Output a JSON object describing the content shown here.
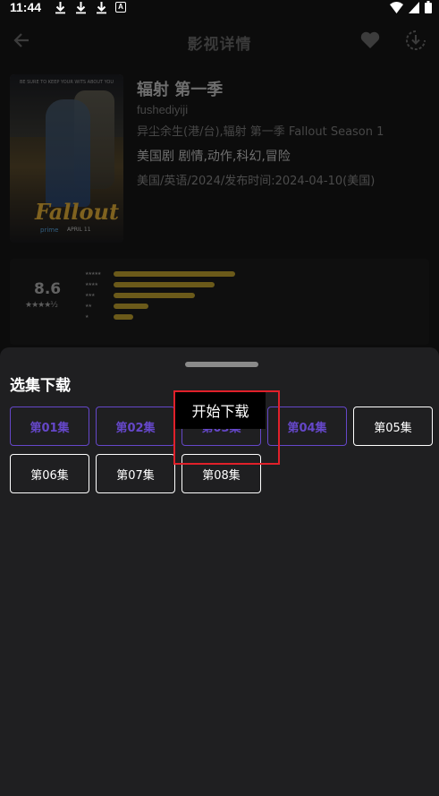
{
  "status_bar": {
    "time": "11:44",
    "a_badge": "A"
  },
  "header": {
    "title": "影视详情",
    "back_icon": "arrow-left-icon",
    "favorite_icon": "heart-icon",
    "download_icon": "download-circle-icon"
  },
  "movie": {
    "title": "辐射 第一季",
    "subtitle": "fushediyiji",
    "aliases": "异尘余生(港/台),辐射 第一季 Fallout Season 1",
    "genres": "美国剧 剧情,动作,科幻,冒险",
    "meta": "美国/英语/2024/发布时间:2024-04-10(美国)",
    "poster": {
      "tagline": "BE SURE TO KEEP YOUR WITS ABOUT YOU",
      "logo": "Fallout",
      "network": "prime",
      "date": "APRIL 11"
    }
  },
  "rating": {
    "score": "8.6",
    "stars": "★★★★½",
    "distribution": [
      {
        "stars": "★★★★★",
        "percent": 100
      },
      {
        "stars": "★★★★",
        "percent": 83
      },
      {
        "stars": "★★★",
        "percent": 67
      },
      {
        "stars": "★★",
        "percent": 29
      },
      {
        "stars": "★",
        "percent": 16
      }
    ]
  },
  "sheet": {
    "title": "选集下载",
    "episodes": [
      "第01集",
      "第02集",
      "第03集",
      "第04集",
      "第05集",
      "第06集",
      "第07集",
      "第08集"
    ],
    "downloaded": [
      1,
      2,
      3,
      4
    ]
  },
  "toast": {
    "text": "开始下载"
  },
  "colors": {
    "accent": "#6547c9",
    "highlight": "#e0202a",
    "rating_bar": "#6b5a1a"
  }
}
